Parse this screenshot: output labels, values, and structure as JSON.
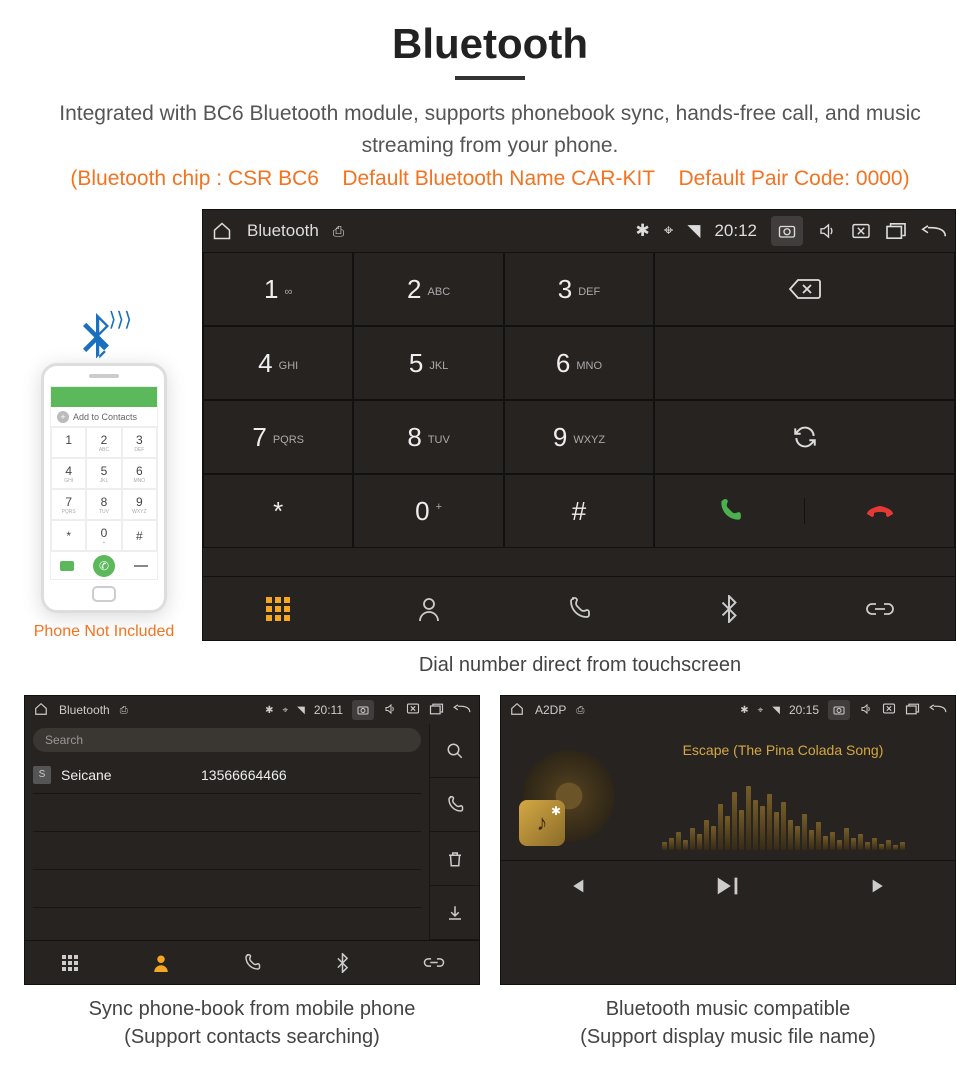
{
  "title": "Bluetooth",
  "desc": "Integrated with BC6 Bluetooth module, supports phonebook sync, hands-free call, and music streaming from your phone.",
  "specs": "(Bluetooth chip : CSR BC6    Default Bluetooth Name CAR-KIT    Default Pair Code: 0000)",
  "phone_note": "Phone Not Included",
  "phone_addcontacts": "Add to Contacts",
  "main": {
    "topbar_title": "Bluetooth",
    "time": "20:12",
    "keys": [
      {
        "num": "1",
        "sub": "∞"
      },
      {
        "num": "2",
        "sub": "ABC"
      },
      {
        "num": "3",
        "sub": "DEF"
      },
      {
        "num": "4",
        "sub": "GHI"
      },
      {
        "num": "5",
        "sub": "JKL"
      },
      {
        "num": "6",
        "sub": "MNO"
      },
      {
        "num": "7",
        "sub": "PQRS"
      },
      {
        "num": "8",
        "sub": "TUV"
      },
      {
        "num": "9",
        "sub": "WXYZ"
      },
      {
        "num": "*",
        "sub": ""
      },
      {
        "num": "0",
        "sub": ""
      },
      {
        "num": "#",
        "sub": ""
      }
    ],
    "zero_sup": "+"
  },
  "main_caption": "Dial number direct from touchscreen",
  "contacts": {
    "topbar_title": "Bluetooth",
    "time": "20:11",
    "search_placeholder": "Search",
    "rows": [
      {
        "badge": "S",
        "name": "Seicane",
        "number": "13566664466"
      }
    ],
    "caption_l1": "Sync phone-book from mobile phone",
    "caption_l2": "(Support contacts searching)"
  },
  "music": {
    "topbar_title": "A2DP",
    "time": "20:15",
    "song": "Escape (The Pina Colada Song)",
    "caption_l1": "Bluetooth music compatible",
    "caption_l2": "(Support display music file name)"
  }
}
